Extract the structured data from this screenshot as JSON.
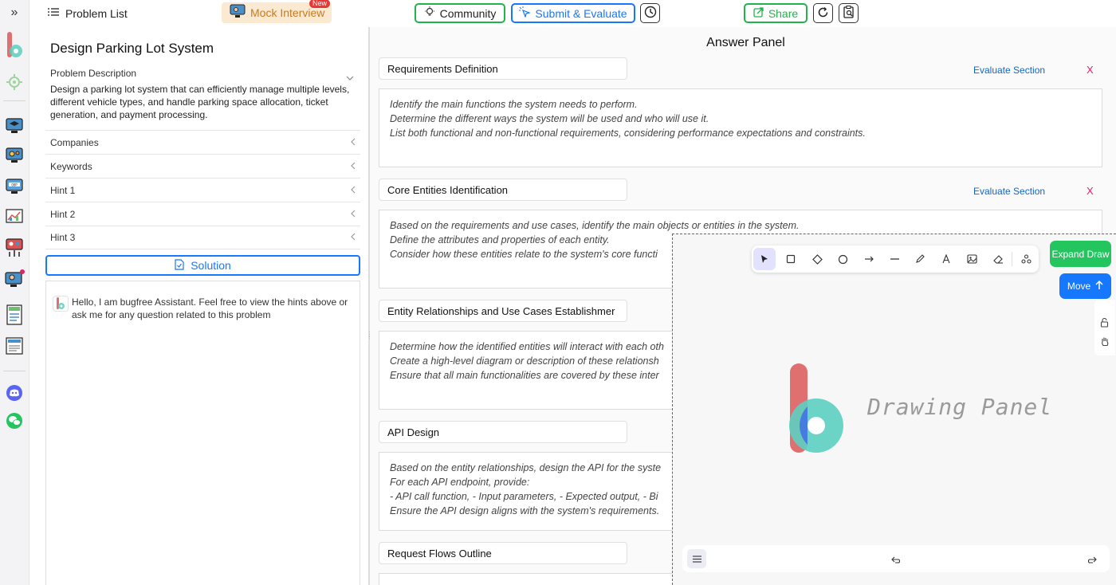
{
  "sidebar": {
    "expand_glyph": "»"
  },
  "topbar": {
    "problem_list": "Problem List",
    "mock_interview": "Mock Interview",
    "new_badge": "New",
    "community": "Community",
    "submit_evaluate": "Submit & Evaluate",
    "share": "Share"
  },
  "problem": {
    "title": "Design Parking Lot System",
    "description_header": "Problem Description",
    "description": "Design a parking lot system that can efficiently manage multiple levels, different vehicle types, and handle parking space allocation, ticket generation, and payment processing.",
    "sections": [
      "Companies",
      "Keywords",
      "Hint 1",
      "Hint 2",
      "Hint 3"
    ],
    "solution_label": "Solution"
  },
  "chat": {
    "message": "Hello, I am bugfree Assistant. Feel free to view the hints above or ask me for any question related to this problem"
  },
  "answer": {
    "title": "Answer Panel",
    "evaluate_label": "Evaluate Section",
    "close_label": "X",
    "sections": [
      {
        "title": "Requirements Definition",
        "body": "Identify the main functions the system needs to perform.\n Determine the different ways the system will be used and who will use it.\n List both functional and non-functional requirements, considering performance expectations and constraints."
      },
      {
        "title": "Core Entities Identification",
        "body": "Based on the requirements and use cases, identify the main objects or entities in the system.\n Define the attributes and properties of each entity.\n Consider how these entities relate to the system's core functi"
      },
      {
        "title": "Entity Relationships and Use Cases Establishmer",
        "body": "Determine how the identified entities will interact with each oth\n Create a high-level diagram or description of these relationsh\n Ensure that all main functionalities are covered by these inter"
      },
      {
        "title": "API Design",
        "body": "Based on the entity relationships, design the API for the syste\n For each API endpoint, provide:\n - API call function, - Input parameters, - Expected output, - Bi\n Ensure the API design aligns with the system's requirements."
      },
      {
        "title": "Request Flows Outline",
        "body": ""
      }
    ]
  },
  "drawing": {
    "panel_label": "Drawing Panel",
    "expand_draw": "Expand Draw",
    "move": "Move"
  },
  "colors": {
    "accent_blue": "#1677ff",
    "green": "#22b34a",
    "brand_red": "#e07070",
    "brand_teal": "#5ccfc0",
    "brand_blue": "#3f6fe6"
  }
}
